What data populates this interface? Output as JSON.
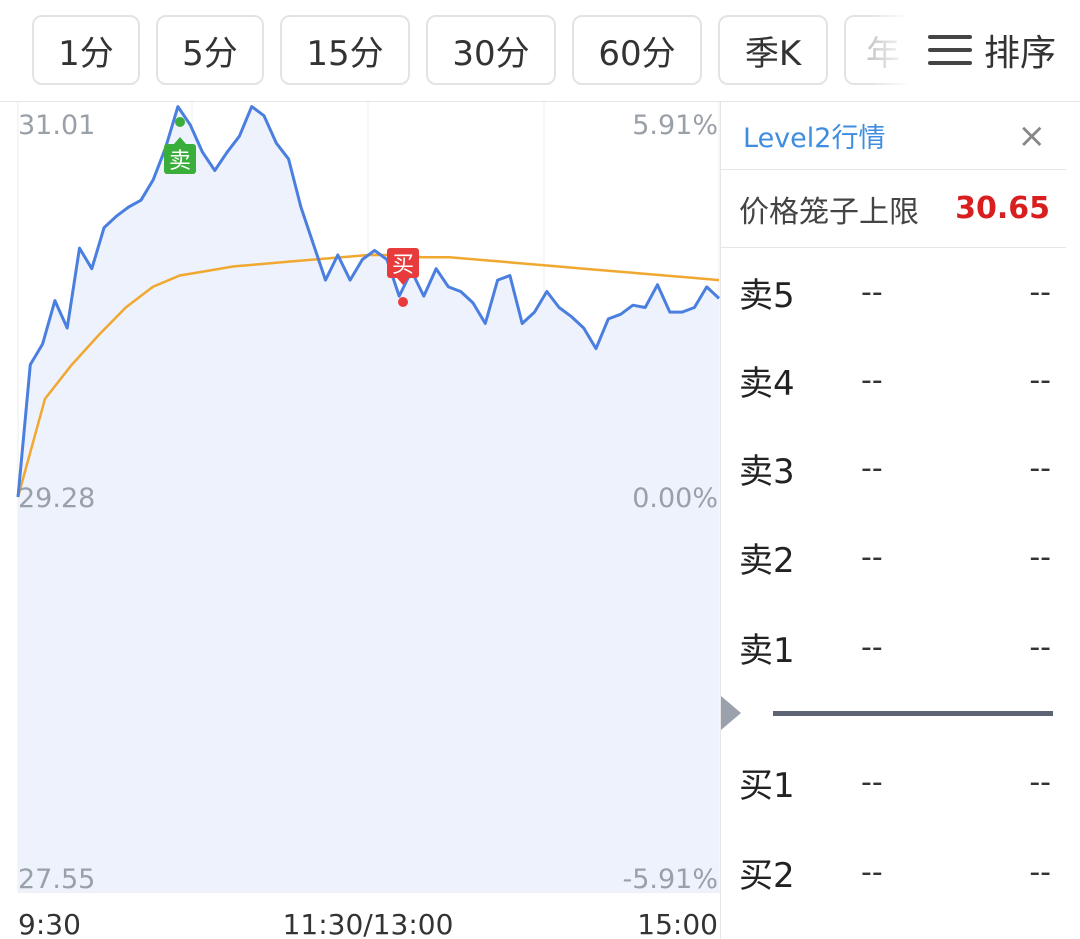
{
  "tabs": [
    {
      "label": "1分"
    },
    {
      "label": "5分"
    },
    {
      "label": "15分"
    },
    {
      "label": "30分"
    },
    {
      "label": "60分"
    },
    {
      "label": "季K"
    },
    {
      "label": "年"
    }
  ],
  "sort": {
    "label": "排序",
    "icon": "menu-icon"
  },
  "chart": {
    "price_high": "31.01",
    "price_base": "29.28",
    "price_low": "27.55",
    "pct_high": "5.91%",
    "pct_base": "0.00%",
    "pct_low": "-5.91%",
    "time_start": "9:30",
    "time_mid": "11:30/13:00",
    "time_end": "15:00",
    "sell_marker": "卖",
    "buy_marker": "买",
    "colors": {
      "price_line": "#4a7fe0",
      "avg_line": "#f0a830",
      "fill": "#eef2fc",
      "sell": "#3aae3a",
      "buy": "#e83c3c"
    }
  },
  "chart_data": {
    "type": "line",
    "ylim": [
      27.55,
      31.01
    ],
    "y_right_pct": [
      -5.91,
      5.91
    ],
    "xlabels": [
      "9:30",
      "11:30/13:00",
      "15:00"
    ],
    "series": [
      {
        "values": [
          29.28,
          29.86,
          29.95,
          30.14,
          30.02,
          30.37,
          30.28,
          30.46,
          30.51,
          30.55,
          30.58,
          30.67,
          30.81,
          30.99,
          30.91,
          30.79,
          30.71,
          30.79,
          30.86,
          30.99,
          30.95,
          30.83,
          30.76,
          30.55,
          30.39,
          30.23,
          30.34,
          30.23,
          30.32,
          30.36,
          30.32,
          30.16,
          30.27,
          30.16,
          30.28,
          30.2,
          30.18,
          30.13,
          30.04,
          30.23,
          30.25,
          30.04,
          30.09,
          30.18,
          30.11,
          30.07,
          30.02,
          29.93,
          30.06,
          30.08,
          30.12,
          30.11,
          30.21,
          30.09,
          30.09,
          30.11,
          30.2,
          30.15
        ],
        "colors": "#4a7fe0"
      },
      {
        "values": [
          29.28,
          29.71,
          29.86,
          29.99,
          30.11,
          30.2,
          30.25,
          30.27,
          30.29,
          30.3,
          30.31,
          30.32,
          30.33,
          30.34,
          30.34,
          30.33,
          30.33,
          30.32,
          30.31,
          30.3,
          30.29,
          30.28,
          30.27,
          30.26,
          30.25,
          30.24,
          30.23
        ],
        "colors": "#f0a830"
      }
    ],
    "markers": [
      {
        "label": "卖",
        "value": 30.93
      },
      {
        "label": "买",
        "value": 30.18
      }
    ]
  },
  "level2": {
    "title": "Level2行情",
    "close_icon": "close-icon",
    "limit_label": "价格笼子上限",
    "limit_value": "30.65",
    "asks": [
      {
        "label": "卖5",
        "price": "--",
        "vol": "--"
      },
      {
        "label": "卖4",
        "price": "--",
        "vol": "--"
      },
      {
        "label": "卖3",
        "price": "--",
        "vol": "--"
      },
      {
        "label": "卖2",
        "price": "--",
        "vol": "--"
      },
      {
        "label": "卖1",
        "price": "--",
        "vol": "--"
      }
    ],
    "bids": [
      {
        "label": "买1",
        "price": "--",
        "vol": "--"
      },
      {
        "label": "买2",
        "price": "--",
        "vol": "--"
      }
    ]
  }
}
